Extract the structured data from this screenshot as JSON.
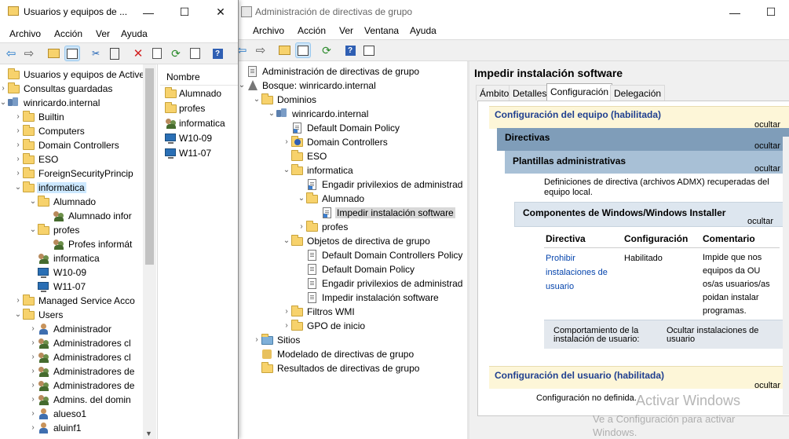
{
  "aduc": {
    "title": "Usuarios y equipos de ...",
    "menu": [
      "Archivo",
      "Acción",
      "Ver",
      "Ayuda"
    ],
    "tree": [
      {
        "label": "Usuarios y equipos de Active D"
      },
      {
        "label": "Consultas guardadas"
      },
      {
        "label": "winricardo.internal"
      },
      {
        "label": "Builtin"
      },
      {
        "label": "Computers"
      },
      {
        "label": "Domain Controllers"
      },
      {
        "label": "ESO"
      },
      {
        "label": "ForeignSecurityPrincip"
      },
      {
        "label": "informatica"
      },
      {
        "label": "Alumnado"
      },
      {
        "label": "Alumnado infor"
      },
      {
        "label": "profes"
      },
      {
        "label": "Profes informát"
      },
      {
        "label": "informatica"
      },
      {
        "label": "W10-09"
      },
      {
        "label": "W11-07"
      },
      {
        "label": "Managed Service Acco"
      },
      {
        "label": "Users"
      },
      {
        "label": "Administrador"
      },
      {
        "label": "Administradores cl"
      },
      {
        "label": "Administradores cl"
      },
      {
        "label": "Administradores de"
      },
      {
        "label": "Administradores de"
      },
      {
        "label": "Admins. del domin"
      },
      {
        "label": "alueso1"
      },
      {
        "label": "aluinf1"
      }
    ],
    "list_header": "Nombre",
    "list": [
      "Alumnado",
      "profes",
      "informatica",
      "W10-09",
      "W11-07"
    ]
  },
  "gpmc": {
    "title": "Administración de directivas de grupo",
    "menu": [
      "Archivo",
      "Acción",
      "Ver",
      "Ventana",
      "Ayuda"
    ],
    "tree": [
      {
        "label": "Administración de directivas de grupo"
      },
      {
        "label": "Bosque: winricardo.internal"
      },
      {
        "label": "Dominios"
      },
      {
        "label": "winricardo.internal"
      },
      {
        "label": "Default Domain Policy"
      },
      {
        "label": "Domain Controllers"
      },
      {
        "label": "ESO"
      },
      {
        "label": "informatica"
      },
      {
        "label": "Engadir privilexios de administrad"
      },
      {
        "label": "Alumnado"
      },
      {
        "label": "Impedir instalación software"
      },
      {
        "label": "profes"
      },
      {
        "label": "Objetos de directiva de grupo"
      },
      {
        "label": "Default Domain Controllers Policy"
      },
      {
        "label": "Default Domain Policy"
      },
      {
        "label": "Engadir privilexios de administrad"
      },
      {
        "label": "Impedir instalación software"
      },
      {
        "label": "Filtros WMI"
      },
      {
        "label": "GPO de inicio"
      },
      {
        "label": "Sitios"
      },
      {
        "label": "Modelado de directivas de grupo"
      },
      {
        "label": "Resultados de directivas de grupo"
      }
    ],
    "detail": {
      "title": "Impedir instalación software",
      "tabs": [
        "Ámbito",
        "Detalles",
        "Configuración",
        "Delegación"
      ],
      "computer_config": "Configuración del equipo (habilitada)",
      "hide": "ocultar",
      "directivas": "Directivas",
      "admin_templates": "Plantillas administrativas",
      "admx_note": "Definiciones de directiva (archivos ADMX) recuperadas del equipo local.",
      "component": "Componentes de Windows/Windows Installer",
      "col_policy": "Directiva",
      "col_setting": "Configuración",
      "col_comment": "Comentario",
      "policy_link": "Prohibir instalaciones de usuario",
      "policy_value": "Habilitado",
      "policy_comment": "Impide que nos equipos da OU os/as usuarios/as poidan instalar programas.",
      "behavior_label": "Comportamiento de la instalación de usuario:",
      "behavior_value": "Ocultar instalaciones de usuario",
      "user_config": "Configuración del usuario (habilitada)",
      "no_defined": "Configuración no definida."
    }
  },
  "watermark": {
    "line1": "Activar Windows",
    "line2": "Ve a Configuración para activar",
    "line3": "Windows."
  },
  "colors": {
    "selection": "#cce8ff",
    "header_band": "#fdf6d8",
    "directivas_band": "#7f9db9",
    "templates_band": "#a8c0d6",
    "component_band": "#dde6ef",
    "link": "#0645ad",
    "config_title": "#1f3f8f"
  }
}
